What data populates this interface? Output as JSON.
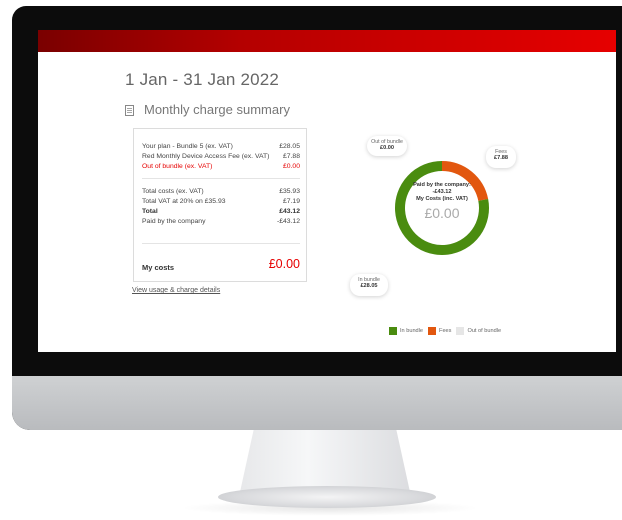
{
  "period": "1 Jan - 31 Jan 2022",
  "summary_title": "Monthly charge summary",
  "lines": [
    {
      "label": "Your plan - Bundle 5 (ex. VAT)",
      "value": "£28.05"
    },
    {
      "label": "Red Monthly Device Access Fee (ex. VAT)",
      "value": "£7.88"
    },
    {
      "label": "Out of bundle (ex. VAT)",
      "value": "£0.00"
    }
  ],
  "totals": [
    {
      "label": "Total costs (ex. VAT)",
      "value": "£35.93"
    },
    {
      "label": "Total VAT at 20% on £35.93",
      "value": "£7.19"
    },
    {
      "label": "Total",
      "value": "£43.12"
    },
    {
      "label": "Paid by the company",
      "value": "-£43.12"
    }
  ],
  "my_costs": {
    "label": "My costs",
    "value": "£0.00"
  },
  "usage_link": "View usage & charge details",
  "chart": {
    "out_of_bundle": {
      "label": "Out of bundle",
      "value": "£0.00"
    },
    "fees": {
      "label": "Fees",
      "value": "£7.88"
    },
    "in_bundle": {
      "label": "In bundle",
      "value": "£28.05"
    },
    "center": {
      "paid_label": "Paid by the company:",
      "paid_value": "-£43.12",
      "my_label": "My Costs (inc. VAT)",
      "my_value": "£0.00"
    }
  },
  "chart_data": {
    "type": "pie",
    "categories": [
      "In bundle",
      "Fees",
      "Out of bundle"
    ],
    "values": [
      28.05,
      7.88,
      0.0
    ],
    "colors": [
      "#4a8c0f",
      "#e2570f",
      "#e6e6e6"
    ],
    "legend_position": "bottom-right"
  },
  "legend": {
    "in_bundle": "In bundle",
    "fees": "Fees",
    "out_of_bundle": "Out of bundle"
  },
  "colors": {
    "brand_red": "#e60000",
    "in_bundle": "#4a8c0f",
    "fees": "#e2570f",
    "out_of_bundle": "#e6e6e6"
  }
}
